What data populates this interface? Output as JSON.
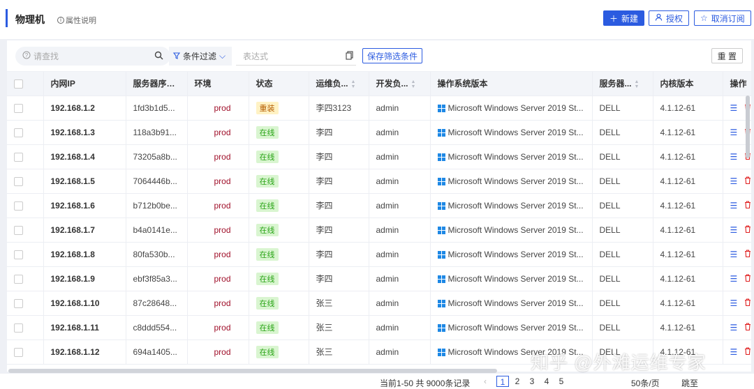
{
  "header": {
    "title": "物理机",
    "help_label": "属性说明",
    "new_label": "新建",
    "authorize_label": "授权",
    "unsubscribe_label": "取消订阅"
  },
  "filter": {
    "search_placeholder": "请查找",
    "condition_label": "条件过滤",
    "expression_placeholder": "表达式",
    "save_label": "保存筛选条件",
    "reset_label": "重 置"
  },
  "table": {
    "columns": [
      "内网IP",
      "服务器序列号",
      "环境",
      "状态",
      "运维负...",
      "开发负...",
      "操作系统版本",
      "服务器...",
      "内核版本",
      "操作"
    ],
    "rows": [
      {
        "ip": "192.168.1.2",
        "serial": "1fd3b1d5...",
        "env": "prod",
        "status": "重装",
        "ops": "李四3123",
        "dev": "admin",
        "os": "Microsoft Windows Server 2019 St...",
        "vendor": "DELL",
        "kernel": "4.1.12-61"
      },
      {
        "ip": "192.168.1.3",
        "serial": "118a3b91...",
        "env": "prod",
        "status": "在线",
        "ops": "李四",
        "dev": "admin",
        "os": "Microsoft Windows Server 2019 St...",
        "vendor": "DELL",
        "kernel": "4.1.12-61"
      },
      {
        "ip": "192.168.1.4",
        "serial": "73205a8b...",
        "env": "prod",
        "status": "在线",
        "ops": "李四",
        "dev": "admin",
        "os": "Microsoft Windows Server 2019 St...",
        "vendor": "DELL",
        "kernel": "4.1.12-61"
      },
      {
        "ip": "192.168.1.5",
        "serial": "7064446b...",
        "env": "prod",
        "status": "在线",
        "ops": "李四",
        "dev": "admin",
        "os": "Microsoft Windows Server 2019 St...",
        "vendor": "DELL",
        "kernel": "4.1.12-61"
      },
      {
        "ip": "192.168.1.6",
        "serial": "b712b0be...",
        "env": "prod",
        "status": "在线",
        "ops": "李四",
        "dev": "admin",
        "os": "Microsoft Windows Server 2019 St...",
        "vendor": "DELL",
        "kernel": "4.1.12-61"
      },
      {
        "ip": "192.168.1.7",
        "serial": "b4a0141e...",
        "env": "prod",
        "status": "在线",
        "ops": "李四",
        "dev": "admin",
        "os": "Microsoft Windows Server 2019 St...",
        "vendor": "DELL",
        "kernel": "4.1.12-61"
      },
      {
        "ip": "192.168.1.8",
        "serial": "80fa530b...",
        "env": "prod",
        "status": "在线",
        "ops": "李四",
        "dev": "admin",
        "os": "Microsoft Windows Server 2019 St...",
        "vendor": "DELL",
        "kernel": "4.1.12-61"
      },
      {
        "ip": "192.168.1.9",
        "serial": "ebf3f85a3...",
        "env": "prod",
        "status": "在线",
        "ops": "李四",
        "dev": "admin",
        "os": "Microsoft Windows Server 2019 St...",
        "vendor": "DELL",
        "kernel": "4.1.12-61"
      },
      {
        "ip": "192.168.1.10",
        "serial": "87c28648...",
        "env": "prod",
        "status": "在线",
        "ops": "张三",
        "dev": "admin",
        "os": "Microsoft Windows Server 2019 St...",
        "vendor": "DELL",
        "kernel": "4.1.12-61"
      },
      {
        "ip": "192.168.1.11",
        "serial": "c8ddd554...",
        "env": "prod",
        "status": "在线",
        "ops": "张三",
        "dev": "admin",
        "os": "Microsoft Windows Server 2019 St...",
        "vendor": "DELL",
        "kernel": "4.1.12-61"
      },
      {
        "ip": "192.168.1.12",
        "serial": "694a1405...",
        "env": "prod",
        "status": "在线",
        "ops": "张三",
        "dev": "admin",
        "os": "Microsoft Windows Server 2019 St...",
        "vendor": "DELL",
        "kernel": "4.1.12-61"
      }
    ]
  },
  "pager": {
    "info": "当前1-50 共 9000条记录",
    "pages": [
      "1",
      "2",
      "3",
      "4",
      "5"
    ],
    "current": "1",
    "page_size": "50条/页",
    "jump_label": "跳至"
  },
  "watermark": "知乎 @外滩运维专家",
  "colors": {
    "accent": "#2b5be0",
    "online_bg": "#d9f5d0",
    "online_fg": "#29a416",
    "reinstall_bg": "#fff2c4",
    "reinstall_fg": "#b45c00",
    "env_fg": "#a0102a",
    "delete": "#e02020"
  },
  "icons": [
    "help-icon",
    "plus-icon",
    "user-icon",
    "star-icon",
    "search-icon",
    "filter-icon",
    "chevron-down-icon",
    "copy-icon",
    "sort-icon",
    "windows-icon",
    "list-icon",
    "trash-icon",
    "column-settings-icon"
  ]
}
